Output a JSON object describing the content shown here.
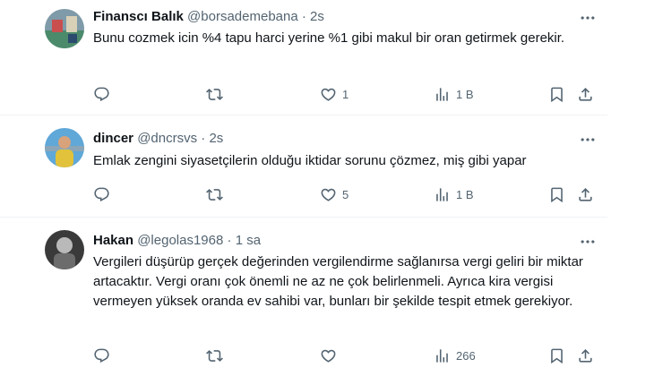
{
  "tweets": [
    {
      "name": "Finanscı Balık",
      "handle": "@borsademebana",
      "dot": "·",
      "time": "2s",
      "text": "Bunu cozmek icin %4 tapu harci yerine %1 gibi makul bir oran getirmek gerekir.",
      "likes": "1",
      "views": "1 B",
      "avatar_colors": [
        "#7f9aa8",
        "#c94f4f",
        "#4b8a6b"
      ]
    },
    {
      "name": "dincer",
      "handle": "@dncrsvs",
      "dot": "·",
      "time": "2s",
      "text": "Emlak zengini siyasetçilerin olduğu iktidar sorunu çözmez, miş gibi yapar",
      "likes": "5",
      "views": "1 B",
      "avatar_colors": [
        "#5fa8d8",
        "#e2c23a",
        "#8aa6b8"
      ]
    },
    {
      "name": "Hakan",
      "handle": "@legolas1968",
      "dot": "·",
      "time": "1 sa",
      "text": "Vergileri düşürüp gerçek değerinden vergilendirme sağlanırsa vergi geliri bir miktar artacaktır. Vergi oranı çok önemli ne az ne çok belirlenmeli. Ayrıca kira vergisi vermeyen yüksek oranda ev sahibi var, bunları bir şekilde tespit etmek gerekiyor.",
      "likes": "",
      "views": "266",
      "avatar_colors": [
        "#3a3a3a",
        "#b9b9b9",
        "#6c6c6c"
      ]
    }
  ],
  "colors": {
    "text": "#0f1419",
    "muted": "#536471",
    "divider": "#eff3f4"
  },
  "icons": [
    "reply-icon",
    "retweet-icon",
    "like-icon",
    "views-icon",
    "bookmark-icon",
    "share-icon",
    "more-icon"
  ]
}
